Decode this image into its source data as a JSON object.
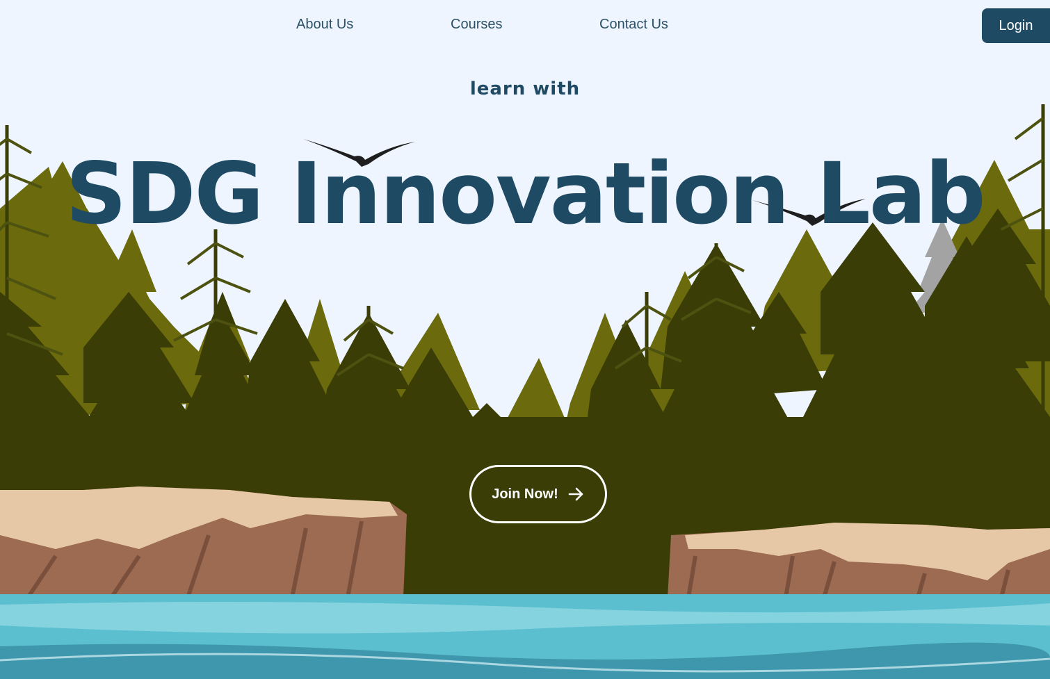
{
  "nav": {
    "links": [
      {
        "label": "About Us"
      },
      {
        "label": "Courses"
      },
      {
        "label": "Contact Us"
      }
    ],
    "login_label": "Login"
  },
  "hero": {
    "tagline": "learn with",
    "title": "SDG Innovation Lab",
    "cta_label": "Join Now!",
    "cta_icon": "arrow-right-icon"
  },
  "illustration": {
    "subject": "forest",
    "colors": {
      "sky": "#eef5ff",
      "brand": "#1f4a63",
      "light_trees": "#6b6a0c",
      "dark_trees": "#3a3d06",
      "cliff_top": "#e6c8a6",
      "cliff_face": "#9c6b52",
      "water": "#5bbfcf"
    }
  }
}
